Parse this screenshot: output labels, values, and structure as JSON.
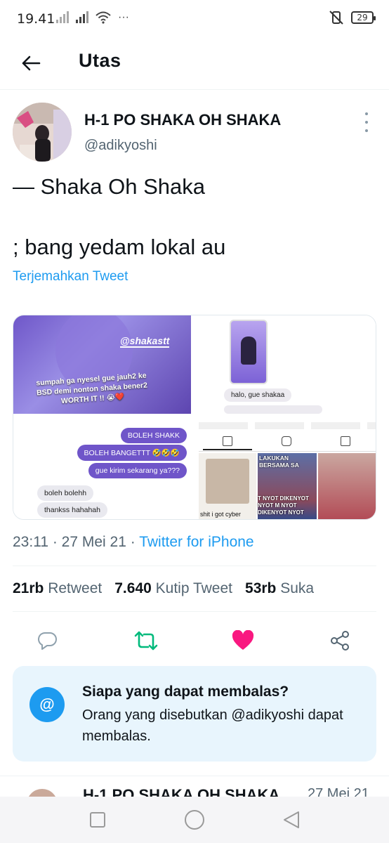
{
  "status_bar": {
    "time": "19.41",
    "extra": "···",
    "battery": "29"
  },
  "header": {
    "title": "Utas"
  },
  "tweet": {
    "display_name": "H-1 PO SHAKA OH SHAKA",
    "handle": "@adikyoshi",
    "text_line1": "— Shaka Oh Shaka",
    "text_line2": "; bang yedam lokal au",
    "translate_label": "Terjemahkan Tweet",
    "media": {
      "m1_tag": "@shakastt",
      "m1_caption": "sumpah ga nyesel gue jauh2 ke BSD demi nonton shaka bener2 WORTH IT !! 😭❤️",
      "m2_chip": "halo, gue shakaa",
      "m3_bubble1": "BOLEH SHAKK",
      "m3_bubble2": "BOLEH BANGETTT 🤣🤣🤣",
      "m3_bubble3": "gue kirim sekarang ya???",
      "m3_bubble4": "boleh bolehh",
      "m3_bubble5": "thankss hahahah",
      "m4_label1": "LAKUKAN BERSAMA SA",
      "m4_label2": "T NYOT DIKENYOT NYOT M NYOT DIKENYOT NYOT",
      "m4_caption": "shit i got cyber"
    },
    "time": "23:11",
    "date": "27 Mei 21",
    "source": "Twitter for iPhone",
    "stats": {
      "retweets_count": "21rb",
      "retweets_label": "Retweet",
      "quotes_count": "7.640",
      "quotes_label": "Kutip Tweet",
      "likes_count": "53rb",
      "likes_label": "Suka"
    },
    "icons": {
      "reply": "reply-icon",
      "retweet": "retweet-icon",
      "like": "heart-icon",
      "share": "share-icon"
    },
    "colors": {
      "retweet": "#00ba7c",
      "like": "#f91880",
      "link": "#1d9bf0"
    }
  },
  "reply_restriction": {
    "title": "Siapa yang dapat membalas?",
    "description": "Orang yang disebutkan @adikyoshi dapat membalas."
  },
  "next_tweet": {
    "display_name": "H-1 PO SHAKA OH SHAKA",
    "time": "27 Mei 21"
  }
}
